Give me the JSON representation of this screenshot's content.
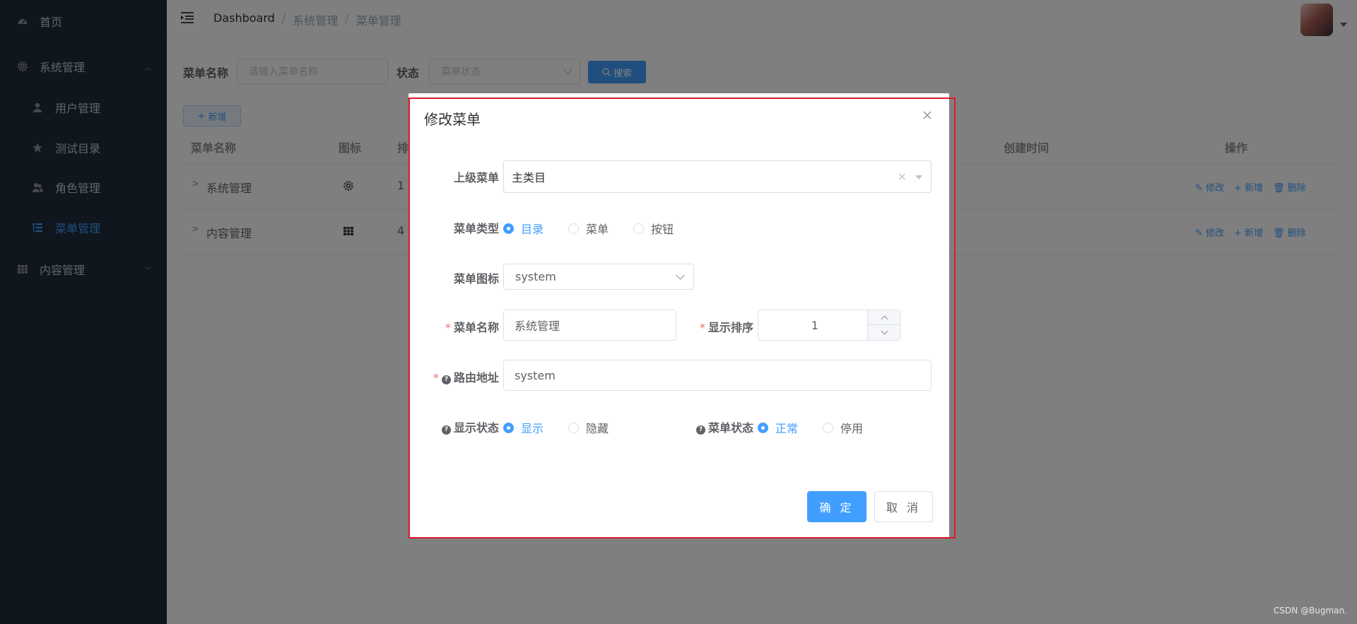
{
  "sidebar": {
    "items": [
      {
        "label": "首页",
        "icon": "dashboard-icon"
      },
      {
        "label": "系统管理",
        "icon": "gear-icon",
        "expanded": true
      },
      {
        "label": "内容管理",
        "icon": "grid-icon",
        "expanded": false
      }
    ],
    "sub_items": [
      {
        "label": "用户管理",
        "icon": "user-icon"
      },
      {
        "label": "测试目录",
        "icon": "star-icon"
      },
      {
        "label": "角色管理",
        "icon": "peoples-icon"
      },
      {
        "label": "菜单管理",
        "icon": "tree-table-icon",
        "active": true
      }
    ]
  },
  "header": {
    "breadcrumb": [
      "Dashboard",
      "系统管理",
      "菜单管理"
    ],
    "breadcrumb_sep": "/"
  },
  "search": {
    "name_label": "菜单名称",
    "name_placeholder": "请输入菜单名称",
    "status_label": "状态",
    "status_placeholder": "菜单状态",
    "search_button": "搜索",
    "add_button": "新增"
  },
  "table": {
    "columns": [
      "菜单名称",
      "图标",
      "排",
      "创建时间",
      "操作"
    ],
    "rows": [
      {
        "name": "系统管理",
        "icon": "gear-icon",
        "order": "1"
      },
      {
        "name": "内容管理",
        "icon": "grid-icon",
        "order": "4"
      }
    ],
    "actions": {
      "edit": "修改",
      "add": "新增",
      "delete": "删除"
    }
  },
  "dialog": {
    "title": "修改菜单",
    "parent_label": "上级菜单",
    "parent_value": "主类目",
    "type_label": "菜单类型",
    "type_options": [
      "目录",
      "菜单",
      "按钮"
    ],
    "type_selected": "目录",
    "icon_label": "菜单图标",
    "icon_value": "system",
    "name_label": "菜单名称",
    "name_value": "系统管理",
    "order_label": "显示排序",
    "order_value": "1",
    "path_label": "路由地址",
    "path_value": "system",
    "visible_label": "显示状态",
    "visible_options": [
      "显示",
      "隐藏"
    ],
    "visible_selected": "显示",
    "status_label": "菜单状态",
    "status_options": [
      "正常",
      "停用"
    ],
    "status_selected": "正常",
    "required_mark": "*",
    "ok_button": "确 定",
    "cancel_button": "取 消"
  },
  "watermark": "CSDN @Bugman.",
  "colors": {
    "primary": "#409eff",
    "sidebar_bg": "#1f2d3d",
    "required": "#f56c6c",
    "outline": "#e0192a"
  }
}
